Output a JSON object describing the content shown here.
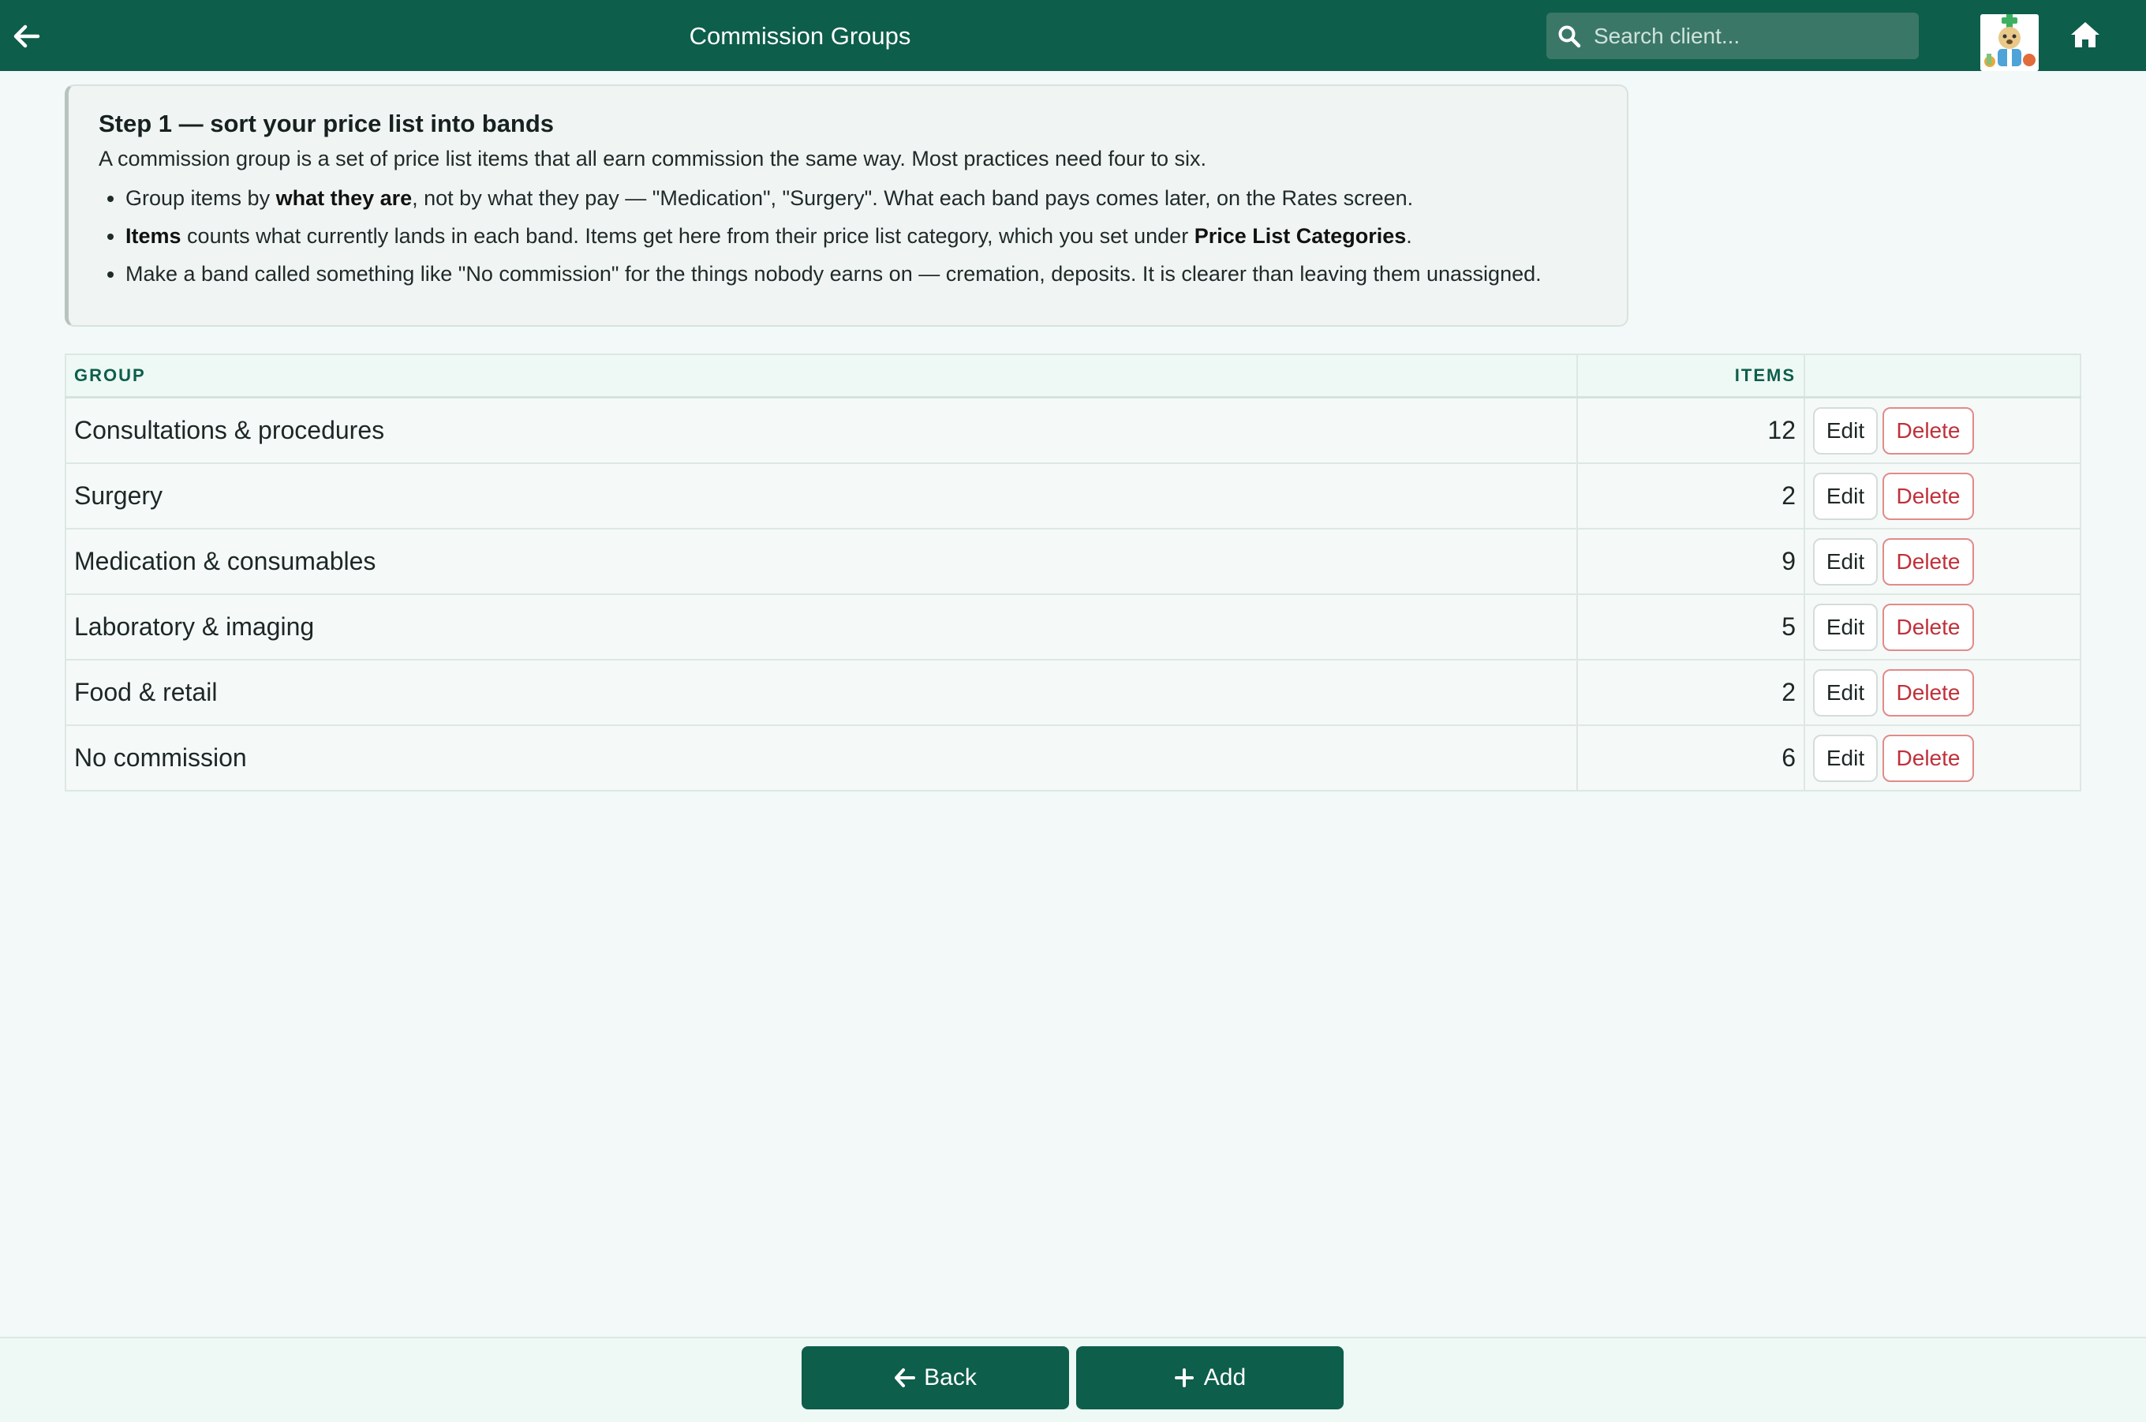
{
  "header": {
    "title": "Commission Groups",
    "search_placeholder": "Search client...",
    "back_icon": "arrow-left-icon",
    "search_icon": "search-icon",
    "home_icon": "home-icon",
    "accent_color": "#0d5e4b"
  },
  "info": {
    "title": "Step 1 — sort your price list into bands",
    "intro": "A commission group is a set of price list items that all earn commission the same way. Most practices need four to six.",
    "bullet1": {
      "pre": "Group items by ",
      "bold": "what they are",
      "post": ", not by what they pay — \"Medication\", \"Surgery\". What each band pays comes later, on the Rates screen."
    },
    "bullet2": {
      "bold": "Items",
      "mid": " counts what currently lands in each band. Items get here from their price list category, which you set under ",
      "bold2": "Price List Categories",
      "post": "."
    },
    "bullet3": "Make a band called something like \"No commission\" for the things nobody earns on — cremation, deposits. It is clearer than leaving them unassigned."
  },
  "table": {
    "headers": {
      "group": "Group",
      "items": "Items"
    },
    "edit_label": "Edit",
    "delete_label": "Delete",
    "rows": [
      {
        "group": "Consultations & procedures",
        "items": "12"
      },
      {
        "group": "Surgery",
        "items": "2"
      },
      {
        "group": "Medication & consumables",
        "items": "9"
      },
      {
        "group": "Laboratory & imaging",
        "items": "5"
      },
      {
        "group": "Food & retail",
        "items": "2"
      },
      {
        "group": "No commission",
        "items": "6"
      }
    ]
  },
  "footer": {
    "back_label": "Back",
    "add_label": "Add"
  }
}
